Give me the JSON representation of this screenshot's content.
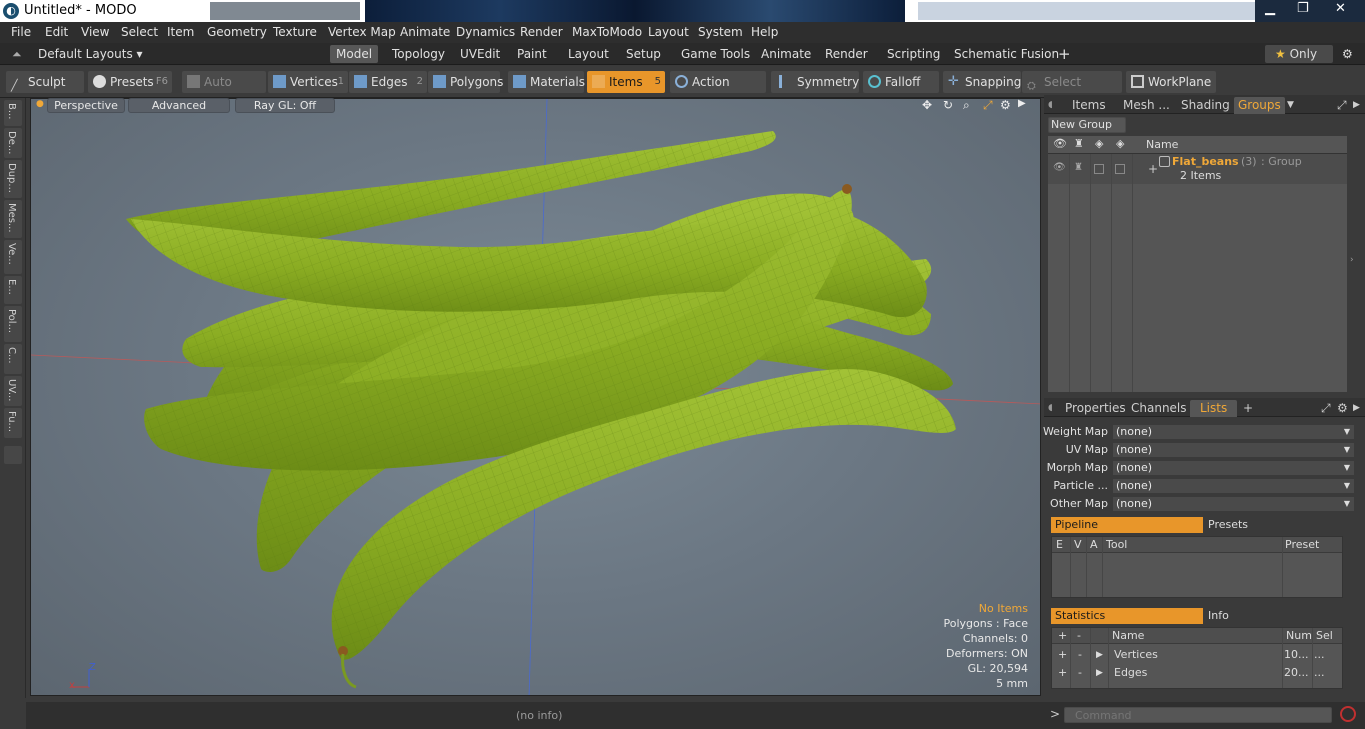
{
  "window": {
    "title": "Untitled* - MODO"
  },
  "menu": [
    "File",
    "Edit",
    "View",
    "Select",
    "Item",
    "Geometry",
    "Texture",
    "Vertex Map",
    "Animate",
    "Dynamics",
    "Render",
    "MaxToModo",
    "Layout",
    "System",
    "Help"
  ],
  "layouts": {
    "dropdown": "Default Layouts",
    "tabs": [
      "Model",
      "Topology",
      "UVEdit",
      "Paint",
      "Layout",
      "Setup",
      "Game Tools",
      "Animate",
      "Render",
      "Scripting",
      "Schematic Fusion"
    ],
    "active": "Model",
    "add": "+",
    "only": "Only"
  },
  "toolbar": {
    "sculpt": "Sculpt",
    "presets": "Presets",
    "presets_key": "F6",
    "auto_select": "Auto Select",
    "vertices": "Vertices",
    "vertices_num": "1",
    "edges": "Edges",
    "edges_num": "2",
    "polygons": "Polygons",
    "materials": "Materials",
    "items": "Items",
    "items_num": "5",
    "action_center": "Action Center",
    "symmetry": "Symmetry",
    "falloff": "Falloff",
    "snapping": "Snapping",
    "select_through": "Select Through",
    "workplane": "WorkPlane"
  },
  "left_tabs": [
    "B...",
    "De...",
    "Dup...",
    "Mes...",
    "Ve...",
    "E...",
    "Pol...",
    "C...",
    "UV...",
    "Fu..."
  ],
  "viewport": {
    "view": "Perspective",
    "shading": "Advanced",
    "raygl": "Ray GL: Off",
    "info": {
      "selection": "No Items",
      "polygons": "Polygons : Face",
      "channels": "Channels: 0",
      "deformers": "Deformers: ON",
      "gl": "GL: 20,594",
      "scale": "5 mm"
    }
  },
  "status": {
    "info": "(no info)"
  },
  "groups_panel": {
    "tabs": [
      "Items",
      "Mesh ...",
      "Shading",
      "Groups"
    ],
    "active": "Groups",
    "new_group": "New Group",
    "col_name": "Name",
    "row": {
      "name": "Flat_beans",
      "count": "(3)",
      "type": ": Group",
      "sub": "2 Items"
    }
  },
  "props_panel": {
    "tabs": [
      "Properties",
      "Channels",
      "Lists"
    ],
    "active": "Lists",
    "maps": [
      {
        "label": "Weight Map",
        "value": "(none)"
      },
      {
        "label": "UV Map",
        "value": "(none)"
      },
      {
        "label": "Morph Map",
        "value": "(none)"
      },
      {
        "label": "Particle ...",
        "value": "(none)"
      },
      {
        "label": "Other Map",
        "value": "(none)"
      }
    ],
    "pipeline": "Pipeline",
    "presets": "Presets",
    "pipeline_cols": [
      "E",
      "V",
      "A",
      "Tool",
      "Preset"
    ],
    "statistics": "Statistics",
    "info": "Info",
    "stat_cols": [
      "+",
      "-",
      "Name",
      "Num",
      "Sel"
    ],
    "stats": [
      {
        "name": "Vertices",
        "num": "10...",
        "sel": "..."
      },
      {
        "name": "Edges",
        "num": "20...",
        "sel": "..."
      }
    ]
  },
  "command": {
    "placeholder": "Command",
    "prompt": ">"
  },
  "colors": {
    "accent": "#e8962a",
    "bean": "#8fb22a",
    "bg": "#3a3a3a"
  }
}
